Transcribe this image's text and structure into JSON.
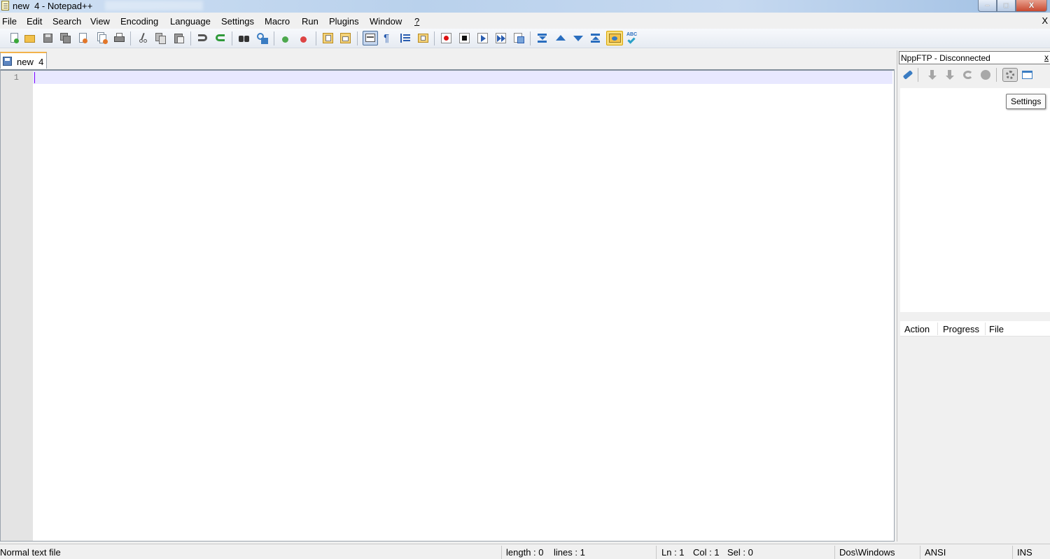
{
  "window": {
    "title": "new  4 - Notepad++",
    "controls": {
      "minimize": "–",
      "maximize": "□",
      "close": "X"
    }
  },
  "menu": {
    "items": [
      "File",
      "Edit",
      "Search",
      "View",
      "Encoding",
      "Language",
      "Settings",
      "Macro",
      "Run",
      "Plugins",
      "Window",
      "?"
    ],
    "close_doc": "X"
  },
  "toolbar": {
    "buttons": [
      "new-file",
      "open-file",
      "save",
      "save-all",
      "close",
      "close-all",
      "print",
      "cut",
      "copy",
      "paste",
      "undo",
      "redo",
      "find",
      "replace",
      "zoom-in",
      "zoom-out",
      "sync-vertical",
      "sync-horizontal",
      "word-wrap",
      "show-all-characters",
      "indent-guide",
      "user-defined-language",
      "macro-record",
      "macro-stop",
      "macro-play",
      "macro-run-multiple",
      "macro-save",
      "fold",
      "previous",
      "next",
      "unfold",
      "nppftp-toggle",
      "spell-check"
    ],
    "accent": "#2a6ebf"
  },
  "tabs": [
    {
      "label": "new  4",
      "active": true
    }
  ],
  "editor": {
    "line_numbers": [
      "1"
    ],
    "current_line_color": "#e8e8ff",
    "caret_color": "#8000ff"
  },
  "ftp_panel": {
    "title": "NppFTP - Disconnected",
    "close": "x",
    "tooltip": "Settings",
    "queue_columns": [
      "Action",
      "Progress",
      "File"
    ]
  },
  "statusbar": {
    "file_type": "Normal text file",
    "length": "length : 0",
    "lines": "lines : 1",
    "ln": "Ln : 1",
    "col": "Col : 1",
    "sel": "Sel : 0",
    "eol": "Dos\\Windows",
    "encoding": "ANSI",
    "mode": "INS"
  }
}
